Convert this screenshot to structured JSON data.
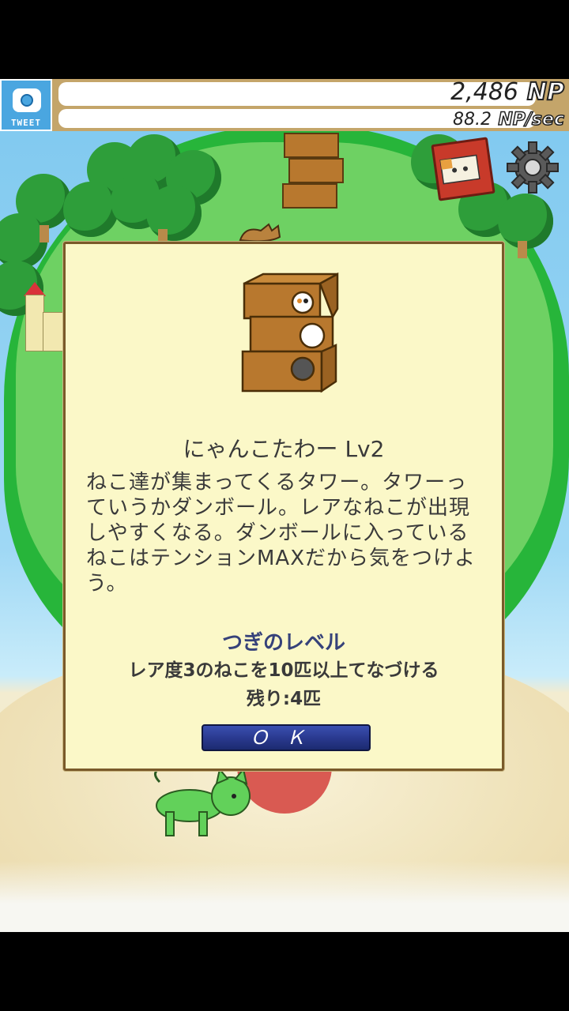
{
  "hud": {
    "tweet_label": "TWEET",
    "np_value": "2,486",
    "np_unit": "NP",
    "rate_value": "88.2",
    "rate_unit": "NP/sec"
  },
  "dialog": {
    "title": "にゃんこたわー Lv2",
    "description": "ねこ達が集まってくるタワー。タワーっていうかダンボール。レアなねこが出現しやすくなる。ダンボールに入っているねこはテンションMAXだから気をつけよう。",
    "next_level_heading": "つぎのレベル",
    "next_level_condition": "レア度3のねこを10匹以上てなづける",
    "remaining": "残り:4匹",
    "ok_label": "ＯＫ"
  },
  "colors": {
    "dialog_bg": "#fbf8c8",
    "ok_button": "#2a3a90",
    "heading": "#36427a"
  },
  "icons": {
    "camera": "camera-icon",
    "book": "book-icon",
    "settings": "gear-icon"
  }
}
